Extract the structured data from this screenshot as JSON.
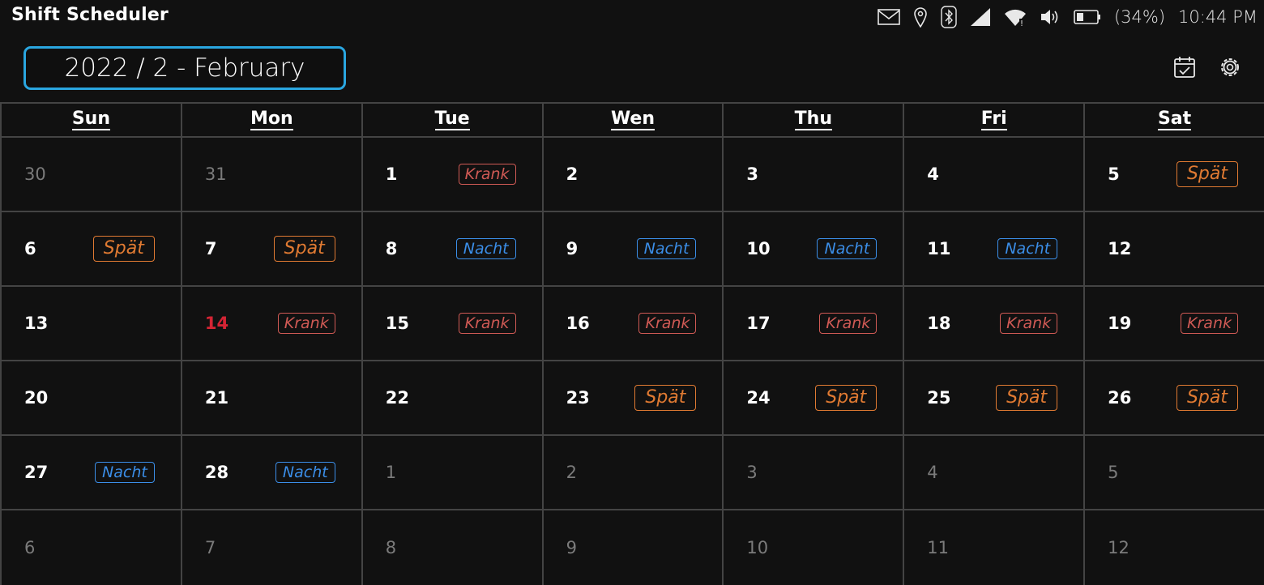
{
  "app": {
    "title": "Shift Scheduler"
  },
  "status_bar": {
    "icons": [
      "mail-icon",
      "location-icon",
      "bluetooth-icon",
      "cellular-signal-icon",
      "wifi-icon",
      "volume-icon",
      "battery-icon"
    ],
    "battery_percent": "(34%)",
    "time": "10:44 PM"
  },
  "header": {
    "month_label": "2022 / 2 - February",
    "icons": [
      "calendar-check-icon",
      "settings-gear-icon"
    ]
  },
  "colors": {
    "accent": "#2aa6e0",
    "today": "#d42434",
    "krank": "#d05a55",
    "spaet": "#e07a32",
    "nacht": "#3b8ee8"
  },
  "calendar": {
    "weekdays": [
      "Sun",
      "Mon",
      "Tue",
      "Wen",
      "Thu",
      "Fri",
      "Sat"
    ],
    "weeks": [
      [
        {
          "day": "30",
          "other": true,
          "shift": null
        },
        {
          "day": "31",
          "other": true,
          "shift": null
        },
        {
          "day": "1",
          "shift": "Krank"
        },
        {
          "day": "2",
          "shift": null
        },
        {
          "day": "3",
          "shift": null
        },
        {
          "day": "4",
          "shift": null
        },
        {
          "day": "5",
          "shift": "Spät"
        }
      ],
      [
        {
          "day": "6",
          "shift": "Spät"
        },
        {
          "day": "7",
          "shift": "Spät"
        },
        {
          "day": "8",
          "shift": "Nacht"
        },
        {
          "day": "9",
          "shift": "Nacht"
        },
        {
          "day": "10",
          "shift": "Nacht"
        },
        {
          "day": "11",
          "shift": "Nacht"
        },
        {
          "day": "12",
          "shift": null
        }
      ],
      [
        {
          "day": "13",
          "shift": null
        },
        {
          "day": "14",
          "today": true,
          "shift": "Krank"
        },
        {
          "day": "15",
          "shift": "Krank"
        },
        {
          "day": "16",
          "shift": "Krank"
        },
        {
          "day": "17",
          "shift": "Krank"
        },
        {
          "day": "18",
          "shift": "Krank"
        },
        {
          "day": "19",
          "shift": "Krank"
        }
      ],
      [
        {
          "day": "20",
          "shift": null
        },
        {
          "day": "21",
          "shift": null
        },
        {
          "day": "22",
          "shift": null
        },
        {
          "day": "23",
          "shift": "Spät"
        },
        {
          "day": "24",
          "shift": "Spät"
        },
        {
          "day": "25",
          "shift": "Spät"
        },
        {
          "day": "26",
          "shift": "Spät"
        }
      ],
      [
        {
          "day": "27",
          "shift": "Nacht"
        },
        {
          "day": "28",
          "shift": "Nacht"
        },
        {
          "day": "1",
          "other": true,
          "shift": null
        },
        {
          "day": "2",
          "other": true,
          "shift": null
        },
        {
          "day": "3",
          "other": true,
          "shift": null
        },
        {
          "day": "4",
          "other": true,
          "shift": null
        },
        {
          "day": "5",
          "other": true,
          "shift": null
        }
      ],
      [
        {
          "day": "6",
          "other": true,
          "shift": null
        },
        {
          "day": "7",
          "other": true,
          "shift": null
        },
        {
          "day": "8",
          "other": true,
          "shift": null
        },
        {
          "day": "9",
          "other": true,
          "shift": null
        },
        {
          "day": "10",
          "other": true,
          "shift": null
        },
        {
          "day": "11",
          "other": true,
          "shift": null
        },
        {
          "day": "12",
          "other": true,
          "shift": null
        }
      ]
    ]
  }
}
